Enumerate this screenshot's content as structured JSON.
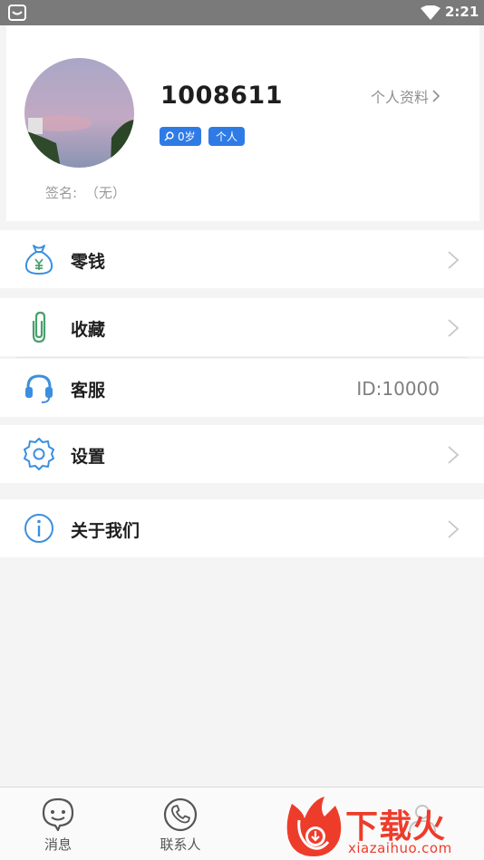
{
  "status_bar": {
    "time": "2:21"
  },
  "profile": {
    "username": "1008611",
    "profile_link": "个人资料",
    "age_tag": "0岁",
    "type_tag": "个人",
    "signature_label": "签名:",
    "signature_value": "（无）"
  },
  "menu": {
    "wallet": "零钱",
    "favorites": "收藏",
    "service": "客服",
    "service_id": "ID:10000",
    "settings": "设置",
    "about": "关于我们"
  },
  "bottom_nav": {
    "messages": "消息",
    "contacts": "联系人"
  },
  "watermark": {
    "text": "下载火",
    "sub": "xiazaihuo.com"
  },
  "colors": {
    "accent": "#2f7be6",
    "icon_blue": "#3b8fe0",
    "icon_green": "#4aa06b",
    "watermark_red": "#ee3c2b",
    "status_bar": "#7a7a7a"
  },
  "icons": {
    "status_left": "notification-icon",
    "status_right": "wifi-icon",
    "wallet": "money-bag-icon",
    "favorites": "paperclip-icon",
    "service": "headset-icon",
    "settings": "gear-icon",
    "about": "info-icon",
    "messages": "chat-bubble-icon",
    "contacts": "phone-icon"
  }
}
